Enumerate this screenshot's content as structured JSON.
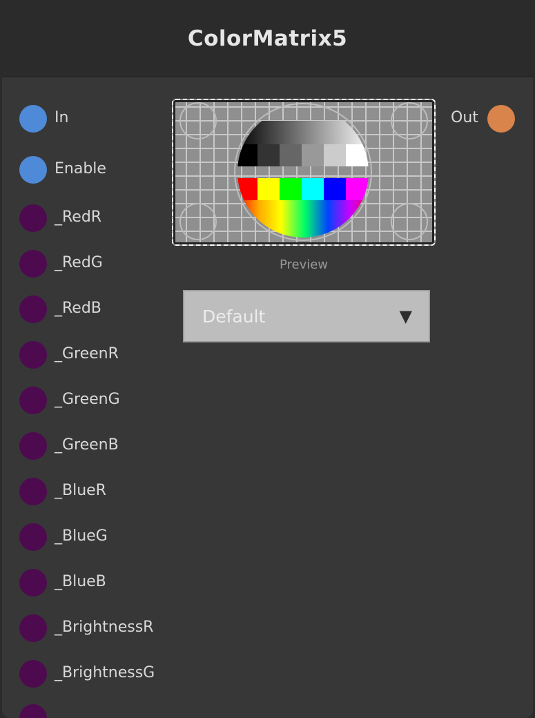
{
  "node": {
    "title": "ColorMatrix5",
    "inputs": [
      {
        "label": "In",
        "color": "#4f8ad8"
      },
      {
        "label": "Enable",
        "color": "#4f8ad8"
      },
      {
        "label": "_RedR",
        "color": "#4d0a4f"
      },
      {
        "label": "_RedG",
        "color": "#4d0a4f"
      },
      {
        "label": "_RedB",
        "color": "#4d0a4f"
      },
      {
        "label": "_GreenR",
        "color": "#4d0a4f"
      },
      {
        "label": "_GreenG",
        "color": "#4d0a4f"
      },
      {
        "label": "_GreenB",
        "color": "#4d0a4f"
      },
      {
        "label": "_BlueR",
        "color": "#4d0a4f"
      },
      {
        "label": "_BlueG",
        "color": "#4d0a4f"
      },
      {
        "label": "_BlueB",
        "color": "#4d0a4f"
      },
      {
        "label": "_BrightnessR",
        "color": "#4d0a4f"
      },
      {
        "label": "_BrightnessG",
        "color": "#4d0a4f"
      }
    ],
    "output": {
      "label": "Out",
      "color": "#d9844b"
    },
    "preview": {
      "label": "Preview"
    },
    "dropdown": {
      "selected": "Default",
      "icon": "triangle-down-icon"
    }
  }
}
